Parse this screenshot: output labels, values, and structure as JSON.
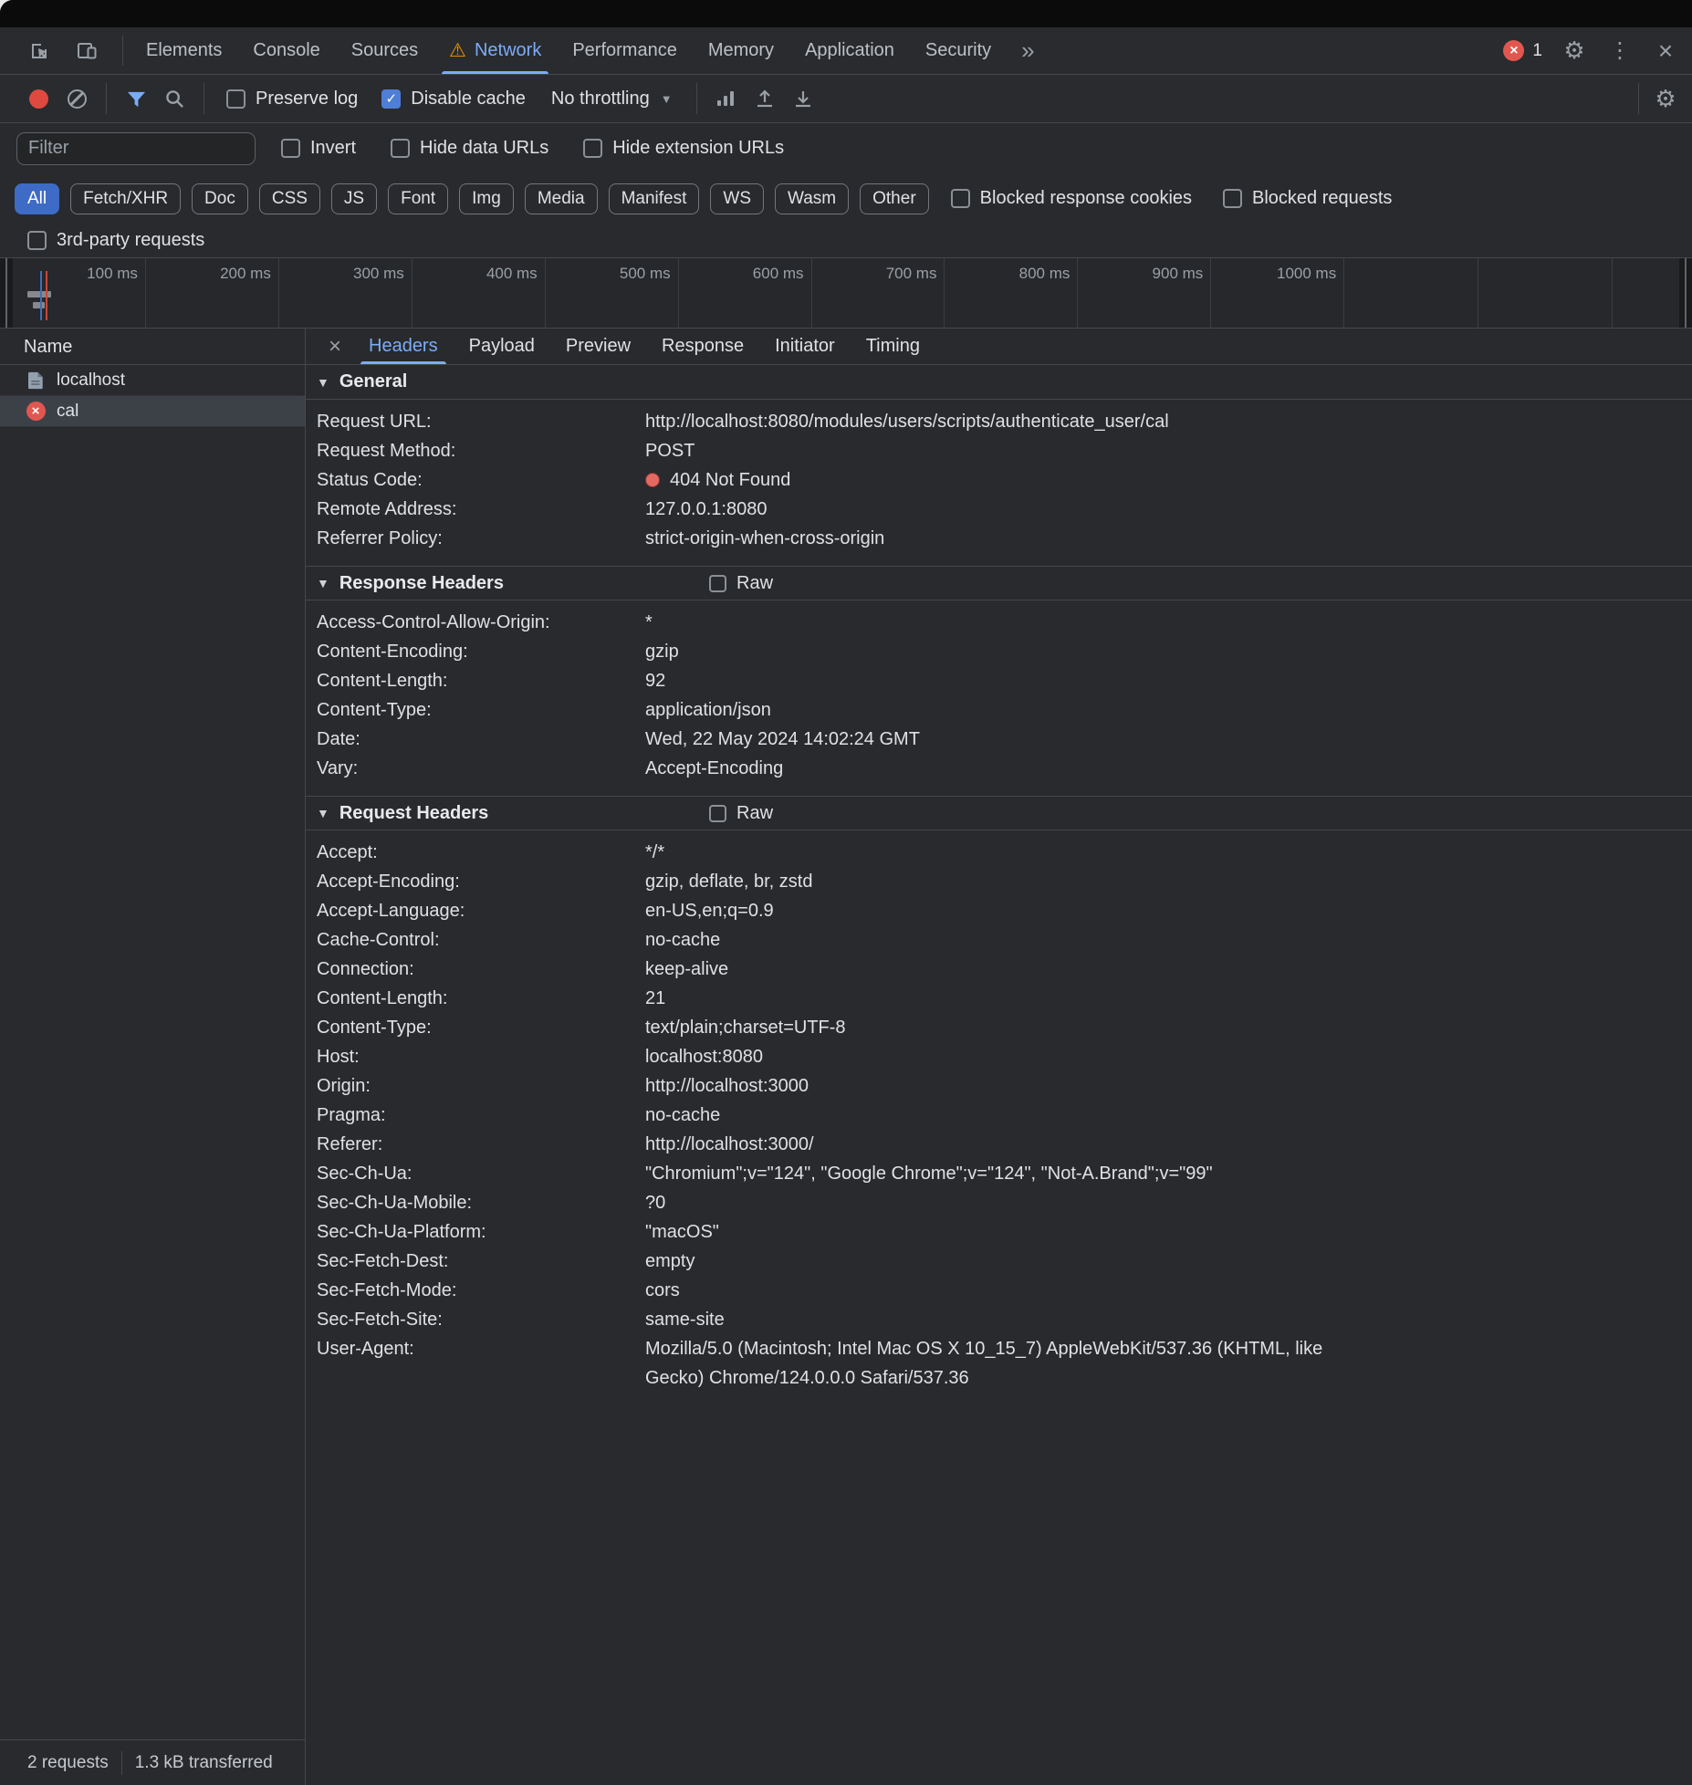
{
  "colors": {
    "accent_blue": "#7cacf8",
    "checkbox_blue": "#4e7fd6",
    "chip_selected_bg": "#3d6bc6",
    "record_red": "#e0493f",
    "error_badge_red": "#e15750",
    "status_dot_red": "#e46962",
    "warning_orange": "#f29900"
  },
  "icons": {
    "more_tabs": "»",
    "gear": "⚙",
    "kebab": "⋮",
    "close": "×",
    "check": "✓",
    "caret_small": "▼",
    "triangle": "▼"
  },
  "tabbar": {
    "tabs": [
      {
        "label": "Elements"
      },
      {
        "label": "Console"
      },
      {
        "label": "Sources"
      },
      {
        "label": "Network",
        "active": true,
        "warn": true
      },
      {
        "label": "Performance"
      },
      {
        "label": "Memory"
      },
      {
        "label": "Application"
      },
      {
        "label": "Security"
      }
    ],
    "error_count": "1"
  },
  "toolbar": {
    "preserve_log_label": "Preserve log",
    "disable_cache_label": "Disable cache",
    "throttling_value": "No throttling"
  },
  "filter_bar": {
    "placeholder": "Filter",
    "invert_label": "Invert",
    "hide_data_label": "Hide data URLs",
    "hide_ext_label": "Hide extension URLs",
    "blocked_cookies_label": "Blocked response cookies",
    "blocked_requests_label": "Blocked requests",
    "third_party_label": "3rd-party requests"
  },
  "filter_chips": [
    {
      "label": "All",
      "active": true
    },
    {
      "label": "Fetch/XHR"
    },
    {
      "label": "Doc"
    },
    {
      "label": "CSS"
    },
    {
      "label": "JS"
    },
    {
      "label": "Font"
    },
    {
      "label": "Img"
    },
    {
      "label": "Media"
    },
    {
      "label": "Manifest"
    },
    {
      "label": "WS"
    },
    {
      "label": "Wasm"
    },
    {
      "label": "Other"
    }
  ],
  "timeline": {
    "ticks": [
      "100 ms",
      "200 ms",
      "300 ms",
      "400 ms",
      "500 ms",
      "600 ms",
      "700 ms",
      "800 ms",
      "900 ms",
      "1000 ms"
    ]
  },
  "requests": {
    "header": "Name",
    "rows": [
      {
        "name": "localhost",
        "icon": "document"
      },
      {
        "name": "cal",
        "icon": "error",
        "selected": true
      }
    ]
  },
  "detail_tabs": [
    {
      "label": "Headers",
      "active": true
    },
    {
      "label": "Payload"
    },
    {
      "label": "Preview"
    },
    {
      "label": "Response"
    },
    {
      "label": "Initiator"
    },
    {
      "label": "Timing"
    }
  ],
  "sections": {
    "general": {
      "title": "General",
      "entries": [
        {
          "key": "Request URL:",
          "value": "http://localhost:8080/modules/users/scripts/authenticate_user/cal"
        },
        {
          "key": "Request Method:",
          "value": "POST"
        },
        {
          "key": "Status Code:",
          "value": "404 Not Found",
          "dot": true
        },
        {
          "key": "Remote Address:",
          "value": "127.0.0.1:8080"
        },
        {
          "key": "Referrer Policy:",
          "value": "strict-origin-when-cross-origin"
        }
      ]
    },
    "response_headers": {
      "title": "Response Headers",
      "raw_label": "Raw",
      "entries": [
        {
          "key": "Access-Control-Allow-Origin:",
          "value": "*"
        },
        {
          "key": "Content-Encoding:",
          "value": "gzip"
        },
        {
          "key": "Content-Length:",
          "value": "92"
        },
        {
          "key": "Content-Type:",
          "value": "application/json"
        },
        {
          "key": "Date:",
          "value": "Wed, 22 May 2024 14:02:24 GMT"
        },
        {
          "key": "Vary:",
          "value": "Accept-Encoding"
        }
      ]
    },
    "request_headers": {
      "title": "Request Headers",
      "raw_label": "Raw",
      "entries": [
        {
          "key": "Accept:",
          "value": "*/*"
        },
        {
          "key": "Accept-Encoding:",
          "value": "gzip, deflate, br, zstd"
        },
        {
          "key": "Accept-Language:",
          "value": "en-US,en;q=0.9"
        },
        {
          "key": "Cache-Control:",
          "value": "no-cache"
        },
        {
          "key": "Connection:",
          "value": "keep-alive"
        },
        {
          "key": "Content-Length:",
          "value": "21"
        },
        {
          "key": "Content-Type:",
          "value": "text/plain;charset=UTF-8"
        },
        {
          "key": "Host:",
          "value": "localhost:8080"
        },
        {
          "key": "Origin:",
          "value": "http://localhost:3000"
        },
        {
          "key": "Pragma:",
          "value": "no-cache"
        },
        {
          "key": "Referer:",
          "value": "http://localhost:3000/"
        },
        {
          "key": "Sec-Ch-Ua:",
          "value": "\"Chromium\";v=\"124\", \"Google Chrome\";v=\"124\", \"Not-A.Brand\";v=\"99\""
        },
        {
          "key": "Sec-Ch-Ua-Mobile:",
          "value": "?0"
        },
        {
          "key": "Sec-Ch-Ua-Platform:",
          "value": "\"macOS\""
        },
        {
          "key": "Sec-Fetch-Dest:",
          "value": "empty"
        },
        {
          "key": "Sec-Fetch-Mode:",
          "value": "cors"
        },
        {
          "key": "Sec-Fetch-Site:",
          "value": "same-site"
        },
        {
          "key": "User-Agent:",
          "value": "Mozilla/5.0 (Macintosh; Intel Mac OS X 10_15_7) AppleWebKit/537.36 (KHTML, like Gecko) Chrome/124.0.0.0 Safari/537.36"
        }
      ]
    }
  },
  "status_bar": {
    "requests": "2 requests",
    "transferred": "1.3 kB transferred"
  }
}
